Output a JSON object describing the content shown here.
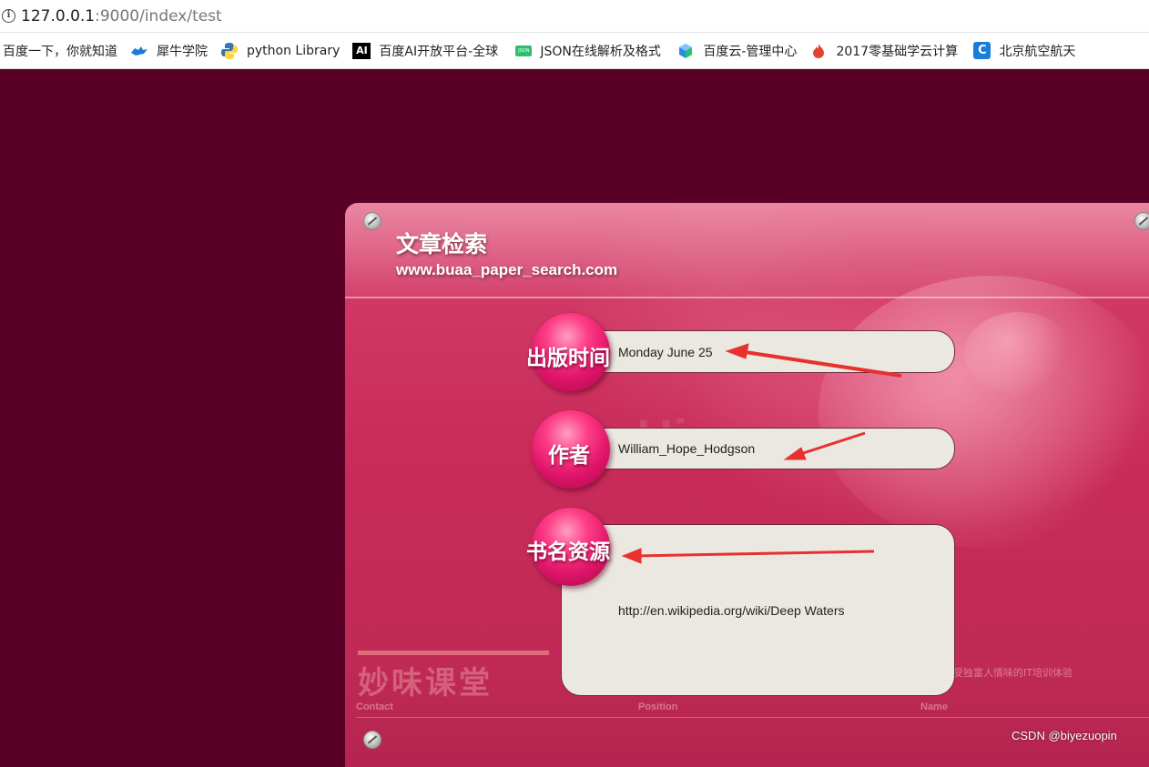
{
  "browser": {
    "url_host": "127.0.0.1",
    "url_rest": ":9000/index/test"
  },
  "bookmarks": [
    {
      "label": "百度一下，你就知道",
      "icon": "none",
      "color": "#222222"
    },
    {
      "label": "犀牛学院",
      "icon": "rhino-icon",
      "color": "#1e7bd6"
    },
    {
      "label": "python Library",
      "icon": "python-icon",
      "color": "#3776ab"
    },
    {
      "label": "百度AI开放平台-全球",
      "icon": "ai-icon",
      "color": "#000000"
    },
    {
      "label": "JSON在线解析及格式",
      "icon": "json-icon",
      "color": "#2bc06a"
    },
    {
      "label": "百度云-管理中心",
      "icon": "cube-icon",
      "color": "#2a8be8"
    },
    {
      "label": "2017零基础学云计算",
      "icon": "flame-icon",
      "color": "#e2442f"
    },
    {
      "label": "北京航空航天",
      "icon": "c-icon",
      "color": "#1a7dd8"
    }
  ],
  "header": {
    "title": "文章检索",
    "subtitle": "www.buaa_paper_search.com"
  },
  "form": {
    "date": {
      "label": "出版时间",
      "value": "Monday June 25"
    },
    "author": {
      "label": "作者",
      "value": "William_Hope_Hodgson"
    },
    "source": {
      "label": "书名资源",
      "value": "http://en.wikipedia.org/wiki/Deep Waters"
    }
  },
  "footer": {
    "brand": "妙味课堂",
    "tagline": "受独富人情味的IT培训体验",
    "col_contact": "Contact",
    "col_position": "Position",
    "col_name": "Name"
  },
  "watermark": "CSDN @biyezuopin",
  "colors": {
    "page_bg": "#5a0026",
    "panel": "#d23865",
    "field_bg": "#ebe8e1",
    "arrow": "#e8312f"
  }
}
